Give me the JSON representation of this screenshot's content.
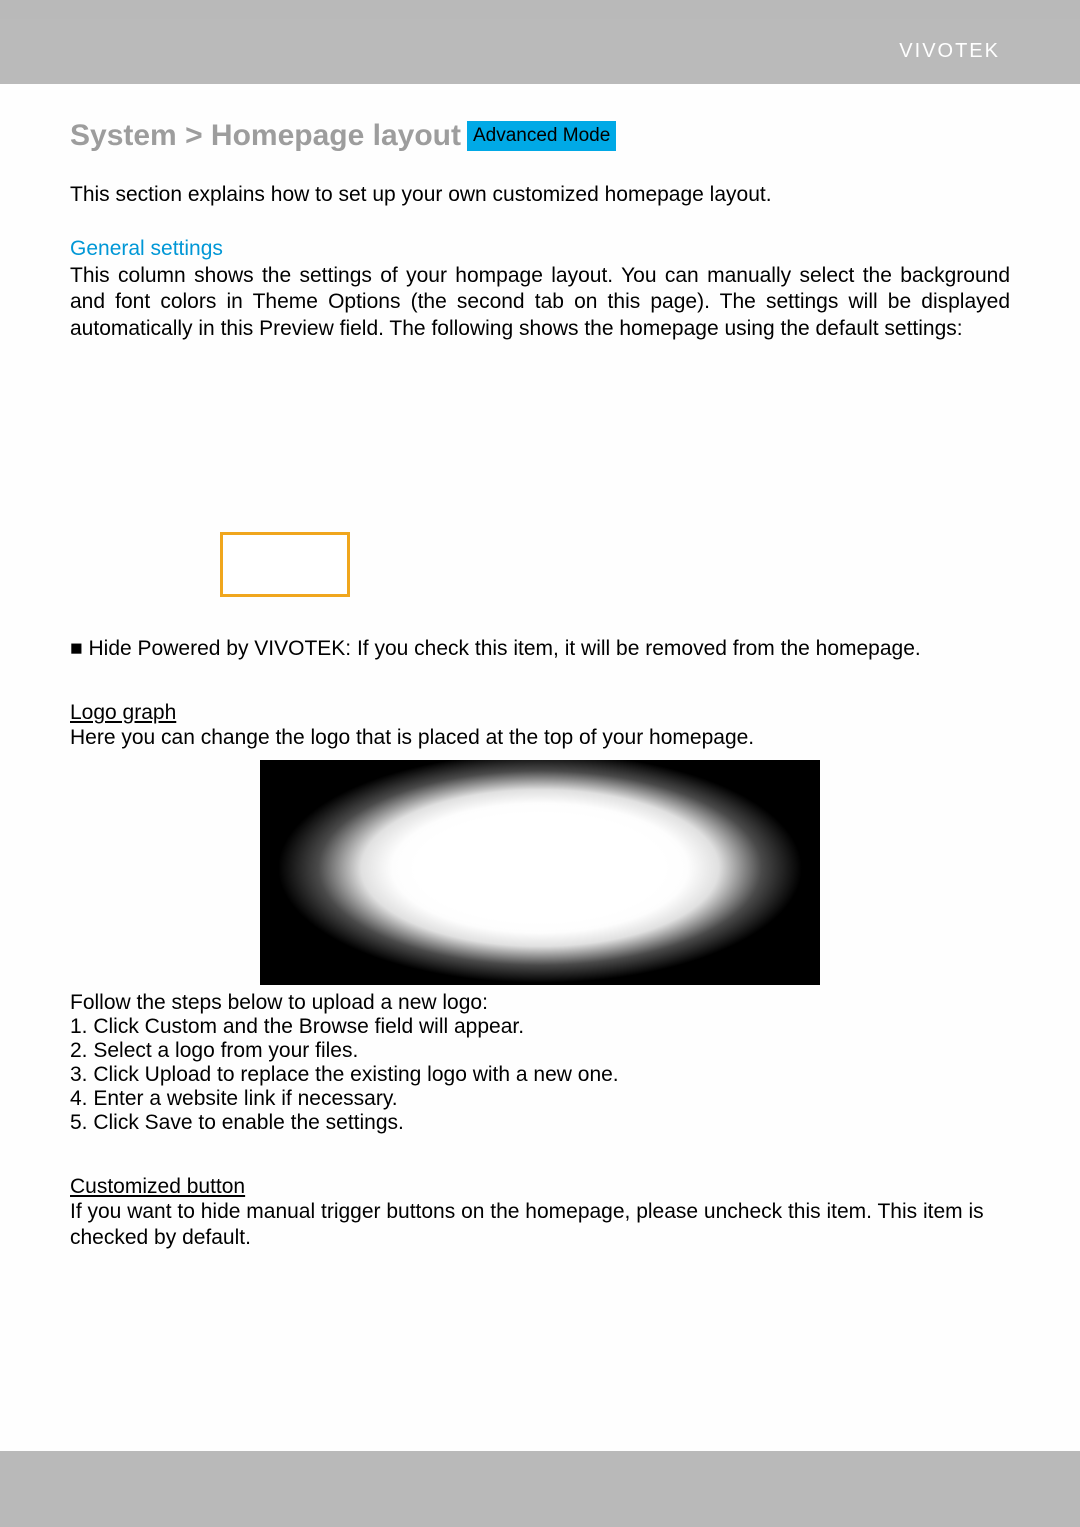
{
  "topbar": {
    "brand": "VIVOTEK"
  },
  "title": {
    "breadcrumb": "System > Homepage layout",
    "mode": "Advanced Mode"
  },
  "intro": "This section explains how to set up your own customized homepage layout.",
  "general": {
    "heading": "General settings",
    "desc": "This column shows the settings of your hompage layout. You can manually select the background and font colors in Theme Options (the second tab on this page). The settings will be displayed automatically in this Preview field. The following shows the homepage using the default settings:"
  },
  "hide_powered": "■ Hide Powered by VIVOTEK: If you check this item, it will be removed from the homepage.",
  "logo": {
    "heading": "Logo graph",
    "desc": "Here you can change the logo that is placed at the top of your homepage.",
    "steps_intro": "Follow the steps below to upload a new logo:",
    "steps": [
      "1. Click Custom and the Browse field will appear.",
      "2. Select a logo from your files.",
      "3. Click Upload to replace the existing logo with a new one.",
      "4. Enter a website link if necessary.",
      "5. Click Save to enable the settings."
    ]
  },
  "custom_button": {
    "heading": "Customized button",
    "desc": "If you want to hide manual trigger buttons on the homepage, please uncheck this item. This item is checked by default."
  },
  "footer": {
    "brand": ""
  }
}
